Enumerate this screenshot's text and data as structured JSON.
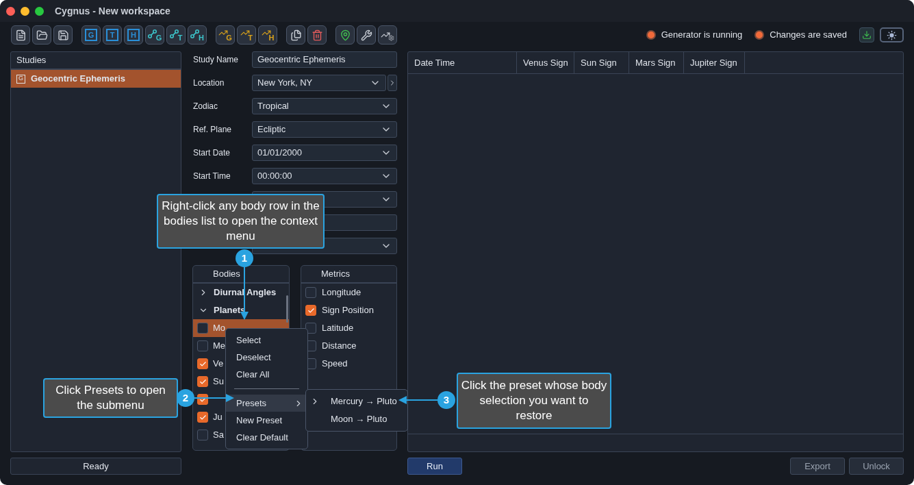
{
  "window": {
    "title": "Cygnus - New workspace"
  },
  "toolbar": [
    {
      "kind": "document"
    },
    {
      "kind": "folder"
    },
    {
      "kind": "save"
    },
    {
      "kind": "gap"
    },
    {
      "kind": "box",
      "letter": "G"
    },
    {
      "kind": "box",
      "letter": "T"
    },
    {
      "kind": "box",
      "letter": "H"
    },
    {
      "kind": "node",
      "letter": "G"
    },
    {
      "kind": "node",
      "letter": "T"
    },
    {
      "kind": "node",
      "letter": "H"
    },
    {
      "kind": "gap"
    },
    {
      "kind": "trend",
      "letter": "G"
    },
    {
      "kind": "trend",
      "letter": "T"
    },
    {
      "kind": "trend",
      "letter": "H"
    },
    {
      "kind": "gap"
    },
    {
      "kind": "copy"
    },
    {
      "kind": "delete"
    },
    {
      "kind": "gap"
    },
    {
      "kind": "pin"
    },
    {
      "kind": "wrench"
    },
    {
      "kind": "trend-settings"
    }
  ],
  "status": [
    {
      "label": "Generator is running",
      "on": true
    },
    {
      "label": "Changes are saved",
      "on": true
    }
  ],
  "studies": {
    "title": "Studies",
    "items": [
      {
        "letter": "G",
        "label": "Geocentric Ephemeris",
        "selected": true
      }
    ]
  },
  "form": [
    {
      "label": "Study Name",
      "kind": "text",
      "value": "Geocentric Ephemeris"
    },
    {
      "label": "Location",
      "kind": "dropdown",
      "value": "New York, NY",
      "side_button": true
    },
    {
      "label": "Zodiac",
      "kind": "dropdown",
      "value": "Tropical"
    },
    {
      "label": "Ref. Plane",
      "kind": "dropdown",
      "value": "Ecliptic"
    },
    {
      "label": "Start Date",
      "kind": "dropdown",
      "value": "01/01/2000"
    },
    {
      "label": "Start Time",
      "kind": "dropdown",
      "value": "00:00:00"
    },
    {
      "kind": "dropdown"
    },
    {
      "kind": "text"
    },
    {
      "kind": "dropdown"
    }
  ],
  "bodies": {
    "title": "Bodies",
    "groups": [
      {
        "label": "Diurnal Angles",
        "expanded": false
      },
      {
        "label": "Planets",
        "expanded": true,
        "children": [
          {
            "label": "Mo",
            "checked": false,
            "selected": true
          },
          {
            "label": "Me",
            "checked": false,
            "selected": false
          },
          {
            "label": "Ve",
            "checked": true,
            "selected": false
          },
          {
            "label": "Su",
            "checked": true,
            "selected": false
          },
          {
            "checked": true,
            "selected": false
          },
          {
            "label": "Ju",
            "checked": true,
            "selected": false
          },
          {
            "label": "Sa",
            "checked": false,
            "selected": false
          }
        ]
      }
    ]
  },
  "metrics": {
    "title": "Metrics",
    "items": [
      {
        "label": "Longitude",
        "checked": false
      },
      {
        "label": "Sign Position",
        "checked": true
      },
      {
        "label": "Latitude",
        "checked": false
      },
      {
        "label": "Distance",
        "checked": false
      },
      {
        "label": "Speed",
        "checked": false
      }
    ]
  },
  "table": {
    "columns": [
      "Date Time",
      "Venus Sign",
      "Sun Sign",
      "Mars Sign",
      "Jupiter Sign"
    ]
  },
  "context_menu": {
    "items": [
      {
        "label": "Select",
        "kind": "item",
        "selected": false
      },
      {
        "label": "Deselect",
        "kind": "item",
        "selected": false
      },
      {
        "label": "Clear All",
        "kind": "item",
        "selected": false
      },
      {
        "kind": "separator"
      },
      {
        "label": "Presets",
        "kind": "submenu",
        "selected": true
      },
      {
        "label": "New Preset",
        "kind": "item",
        "selected": false
      },
      {
        "label": "Clear Default",
        "kind": "item",
        "selected": false
      }
    ],
    "submenu": [
      {
        "label": "Mercury → Pluto",
        "selected": true
      },
      {
        "label": "Moon → Pluto",
        "selected": false
      }
    ]
  },
  "callouts": [
    {
      "number": "1",
      "text": "Right-click any body row in the bodies list to open the context menu"
    },
    {
      "number": "2",
      "text": "Click Presets to open the submenu"
    },
    {
      "number": "3",
      "text": "Click the preset whose body selection you want to restore"
    }
  ],
  "status_bar": "Ready",
  "buttons": [
    {
      "label": "Run",
      "kind": "primary"
    },
    {
      "label": "Export",
      "kind": "secondary"
    },
    {
      "label": "Unlock",
      "kind": "secondary"
    }
  ]
}
